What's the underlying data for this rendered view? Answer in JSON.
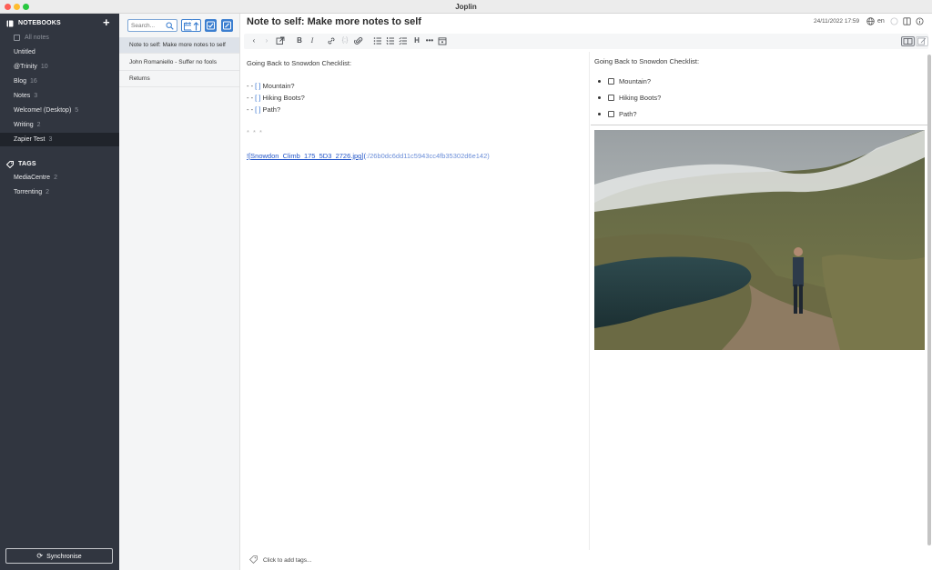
{
  "window": {
    "title": "Joplin"
  },
  "sidebar": {
    "notebooks_header": "NOTEBOOKS",
    "items": [
      {
        "label": "All notes",
        "count": ""
      },
      {
        "label": "Untitled",
        "count": ""
      },
      {
        "label": "@Trinity",
        "count": "10"
      },
      {
        "label": "Blog",
        "count": "16"
      },
      {
        "label": "Notes",
        "count": "3"
      },
      {
        "label": "Welcome! (Desktop)",
        "count": "5"
      },
      {
        "label": "Writing",
        "count": "2"
      },
      {
        "label": "Zapier Test",
        "count": "3"
      }
    ],
    "selected_index": 7,
    "tags_header": "TAGS",
    "tags": [
      {
        "label": "MediaCentre",
        "count": "2"
      },
      {
        "label": "Torrenting",
        "count": "2"
      }
    ],
    "sync_label": "Synchronise"
  },
  "notelist": {
    "search_placeholder": "Search...",
    "notes": [
      {
        "title": "Note to self: Make more notes to self"
      },
      {
        "title": "John Romaniello - Suffer no fools"
      },
      {
        "title": "Returns"
      }
    ]
  },
  "editor": {
    "title": "Note to self: Make more notes to self",
    "date": "24/11/2022 17:59",
    "lang": "en",
    "markdown": {
      "heading": "Going Back to Snowdon Checklist:",
      "items": [
        {
          "prefix": "- - ",
          "box": "[ ]",
          "text": " Mountain?"
        },
        {
          "prefix": "- - ",
          "box": "[ ]",
          "text": " Hiking Boots?"
        },
        {
          "prefix": "- - ",
          "box": "[ ]",
          "text": " Path?"
        }
      ],
      "hr": "* * *",
      "image_prefix": "![",
      "image_alt": "Snowdon_Climb_175_5D3_2726.jpg",
      "image_mid": "](",
      "image_url": ":/26b0dc6dd11c5943cc4fb35302d6e142)"
    },
    "preview": {
      "heading": "Going Back to Snowdon Checklist:",
      "items": [
        "Mountain?",
        "Hiking Boots?",
        "Path?"
      ]
    },
    "tags_placeholder": "Click to add tags..."
  }
}
